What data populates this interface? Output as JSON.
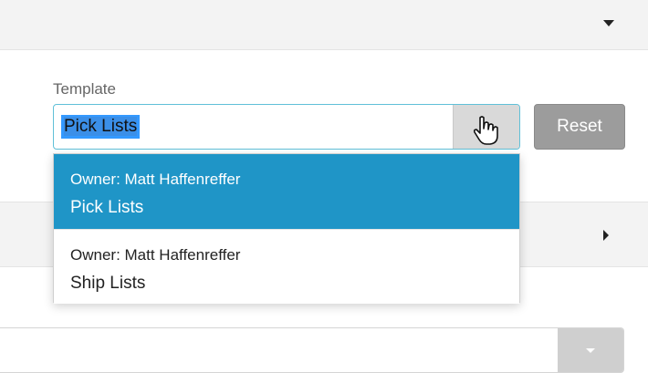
{
  "form": {
    "template_label": "Template",
    "template_value": "Pick Lists",
    "reset_label": "Reset"
  },
  "dropdown": {
    "options": [
      {
        "owner": "Owner: Matt Haffenreffer",
        "name": "Pick Lists",
        "selected": true
      },
      {
        "owner": "Owner: Matt Haffenreffer",
        "name": "Ship Lists",
        "selected": false
      }
    ]
  },
  "colors": {
    "selected_bg": "#1f95c7",
    "focus_border": "#60c0d8",
    "reset_bg": "#9c9c9c"
  },
  "icons": [
    "caret-down-icon",
    "caret-right-icon",
    "hand-pointer-icon"
  ]
}
